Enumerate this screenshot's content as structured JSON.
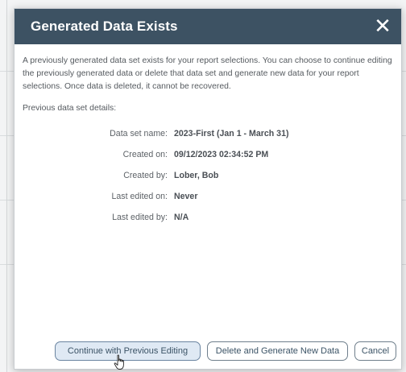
{
  "dialog": {
    "title": "Generated Data Exists",
    "close_icon": "close-icon",
    "intro": "A previously generated data set exists for your report selections. You can choose to continue editing the previously generated data or delete that data set and generate new data for your report selections. Once data is deleted, it cannot be recovered.",
    "section_label": "Previous data set details:",
    "details": [
      {
        "label": "Data set name:",
        "value": "2023-First (Jan 1 - March 31)"
      },
      {
        "label": "Created on:",
        "value": "09/12/2023 02:34:52 PM"
      },
      {
        "label": "Created by:",
        "value": "Lober, Bob"
      },
      {
        "label": "Last edited on:",
        "value": "Never"
      },
      {
        "label": "Last edited by:",
        "value": "N/A"
      }
    ],
    "buttons": {
      "continue": "Continue with Previous Editing",
      "delete": "Delete and Generate New Data",
      "cancel": "Cancel"
    }
  },
  "colors": {
    "titlebar": "#3d5263",
    "primary_button_bg": "#dfe9f4",
    "button_text": "#3b5366"
  },
  "cursor_icon": "hand-pointer-icon"
}
